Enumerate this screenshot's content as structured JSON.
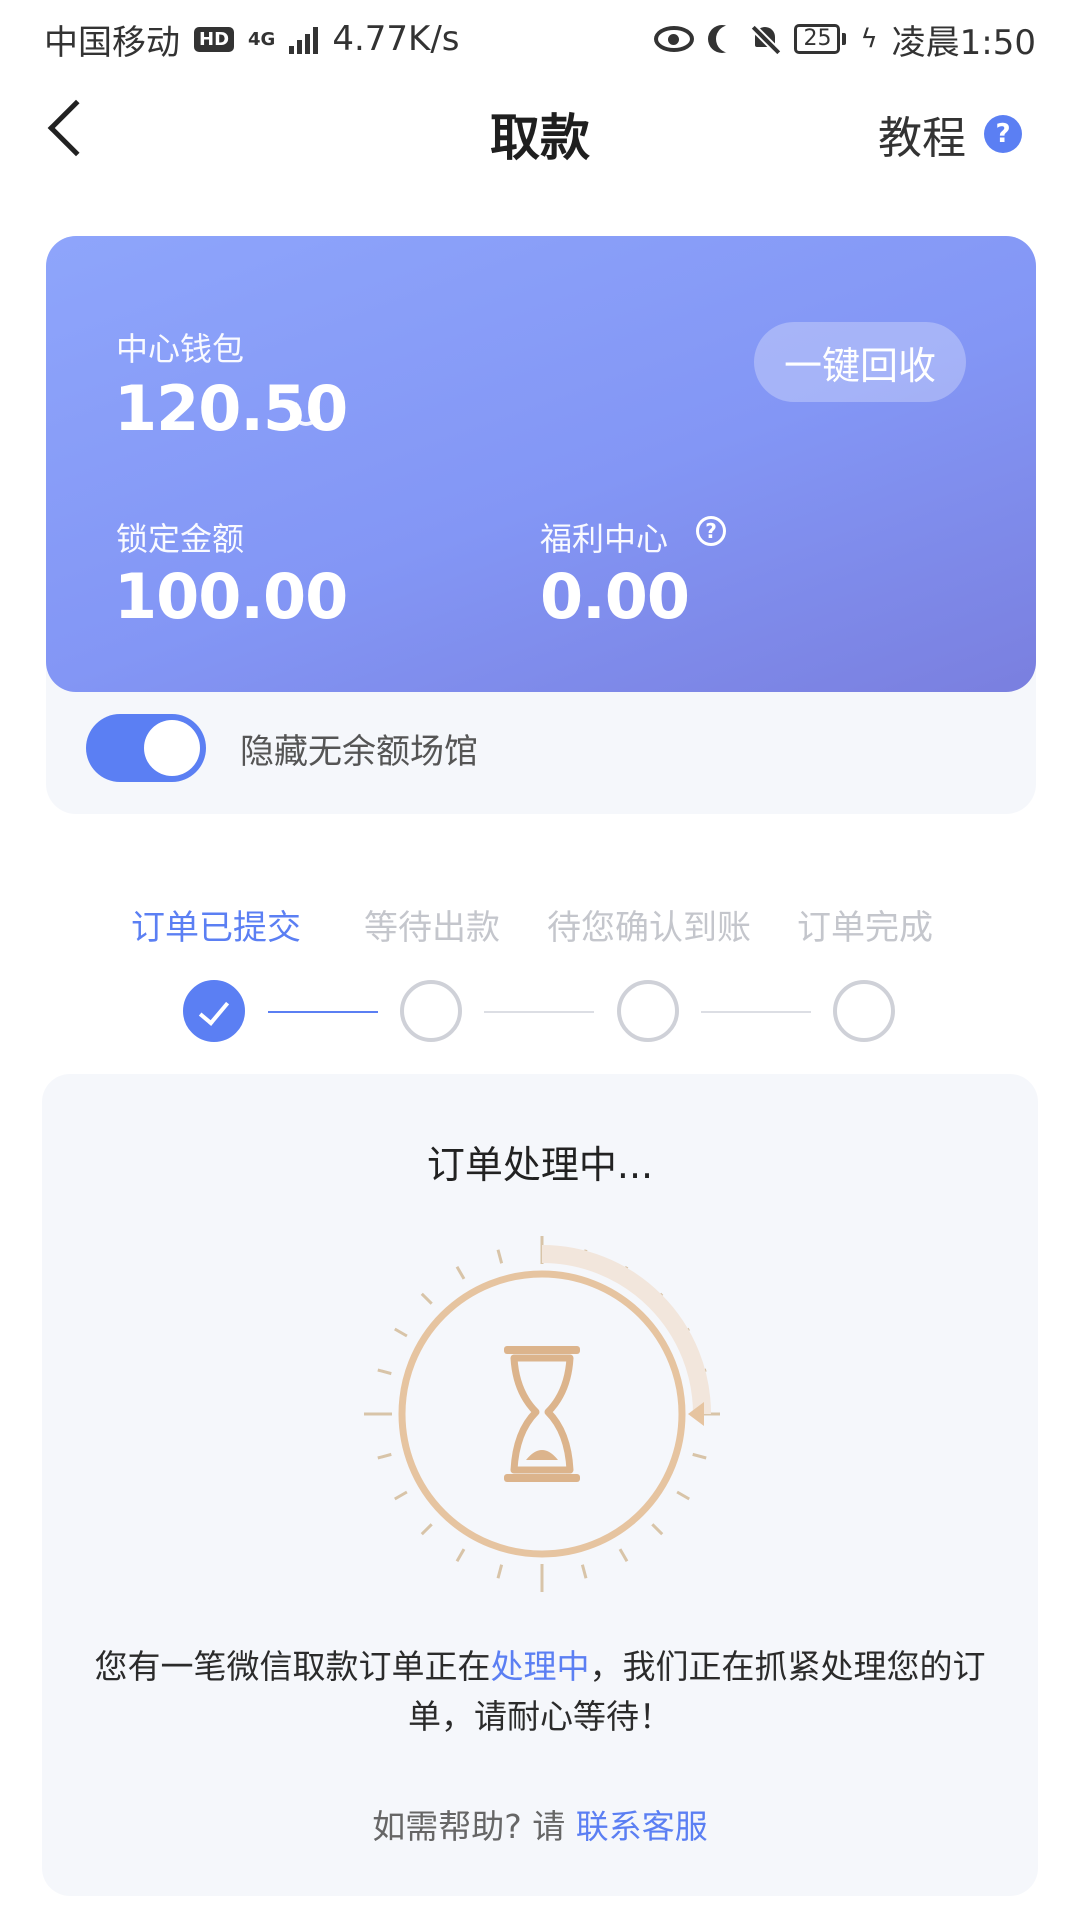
{
  "status_bar": {
    "carrier": "中国移动",
    "hd": "HD",
    "network": "4G",
    "speed": "4.77K/s",
    "battery": "25",
    "time": "凌晨1:50"
  },
  "header": {
    "title": "取款",
    "tutorial": "教程",
    "help_glyph": "?"
  },
  "wallet": {
    "center_label": "中心钱包",
    "center_amount": "120.50",
    "recycle_button": "一键回收",
    "locked_label": "锁定金额",
    "locked_amount": "100.00",
    "welfare_label": "福利中心",
    "welfare_amount": "0.00",
    "welfare_help_glyph": "?"
  },
  "toggle": {
    "label": "隐藏无余额场馆",
    "on": true
  },
  "steps": [
    {
      "label": "订单已提交",
      "state": "done"
    },
    {
      "label": "等待出款",
      "state": "pending"
    },
    {
      "label": "待您确认到账",
      "state": "pending"
    },
    {
      "label": "订单完成",
      "state": "pending"
    }
  ],
  "process": {
    "title": "订单处理中...",
    "message_before": "您有一笔微信取款订单正在",
    "message_highlight": "处理中",
    "message_after": "，我们正在抓紧处理您的订单，请耐心等待！",
    "help_prefix": "如需帮助? 请 ",
    "help_link": "联系客服"
  },
  "colors": {
    "accent": "#5b7ff3",
    "card_gradient_start": "#8ea5fb",
    "card_gradient_end": "#7a7fdf",
    "timer_ring": "#e6c4a0",
    "timer_icon": "#dcb48c"
  }
}
